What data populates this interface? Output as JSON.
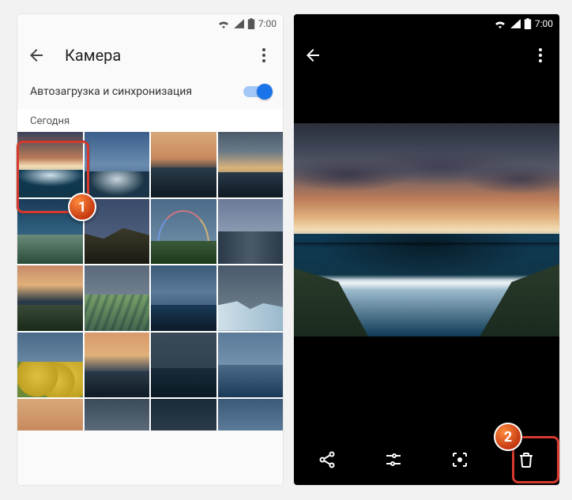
{
  "status": {
    "time": "7:00"
  },
  "left": {
    "title": "Камера",
    "sync_label": "Автозагрузка и синхронизация",
    "section": "Сегодня",
    "badge": "1"
  },
  "right": {
    "badge": "2"
  },
  "icons": {
    "back": "back-arrow-icon",
    "more": "more-vert-icon",
    "share": "share-icon",
    "tune": "tune-icon",
    "lens": "lens-icon",
    "trash": "trash-icon"
  }
}
